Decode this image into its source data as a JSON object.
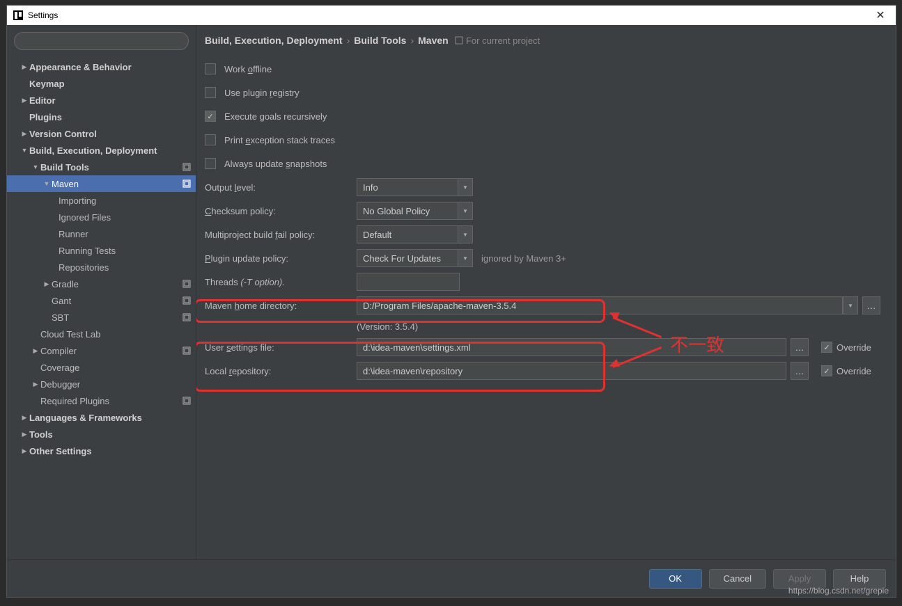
{
  "window": {
    "title": "Settings"
  },
  "search": {
    "placeholder": ""
  },
  "tree": {
    "appearance": "Appearance & Behavior",
    "keymap": "Keymap",
    "editor": "Editor",
    "plugins": "Plugins",
    "vcs": "Version Control",
    "bed": "Build, Execution, Deployment",
    "build_tools": "Build Tools",
    "maven": "Maven",
    "importing": "Importing",
    "ignored": "Ignored Files",
    "runner": "Runner",
    "running_tests": "Running Tests",
    "repos": "Repositories",
    "gradle": "Gradle",
    "gant": "Gant",
    "sbt": "SBT",
    "cloud": "Cloud Test Lab",
    "compiler": "Compiler",
    "coverage": "Coverage",
    "debugger": "Debugger",
    "required": "Required Plugins",
    "lang": "Languages & Frameworks",
    "tools": "Tools",
    "other": "Other Settings"
  },
  "crumbs": {
    "a": "Build, Execution, Deployment",
    "b": "Build Tools",
    "c": "Maven",
    "proj": "For current project"
  },
  "checks": {
    "offline": "Work offline",
    "registry": "Use plugin registry",
    "recursive": "Execute goals recursively",
    "stack": "Print exception stack traces",
    "snapshots": "Always update snapshots"
  },
  "labels": {
    "output": "Output level:",
    "checksum": "Checksum policy:",
    "multi": "Multiproject build fail policy:",
    "plugin_update": "Plugin update policy:",
    "threads": "Threads",
    "threads_hint": "(-T option).",
    "home": "Maven home directory:",
    "version": "(Version: 3.5.4)",
    "user_settings": "User settings file:",
    "local_repo": "Local repository:",
    "ignored": "ignored by Maven 3+",
    "override": "Override"
  },
  "values": {
    "output": "Info",
    "checksum": "No Global Policy",
    "multi": "Default",
    "plugin_update": "Check For Updates",
    "threads": "",
    "home": "D:/Program Files/apache-maven-3.5.4",
    "user_settings": "d:\\idea-maven\\settings.xml",
    "local_repo": "d:\\idea-maven\\repository"
  },
  "buttons": {
    "ok": "OK",
    "cancel": "Cancel",
    "apply": "Apply",
    "help": "Help"
  },
  "annotation": {
    "text": "不一致"
  },
  "watermark": "https://blog.csdn.net/grepie"
}
